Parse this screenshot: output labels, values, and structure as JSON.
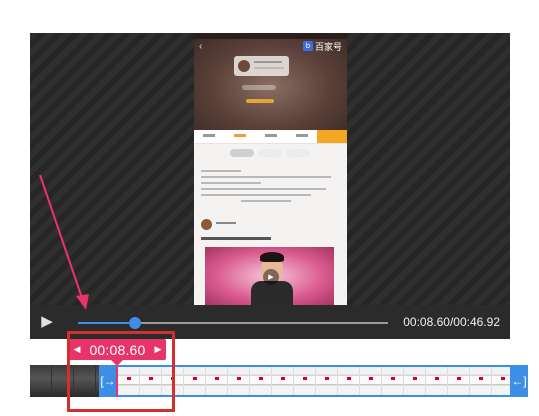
{
  "app": {
    "preview_brand": "百家号"
  },
  "player": {
    "play_icon": "play-icon",
    "time_readout": "00:08.60/00:46.92",
    "progress_fraction": 0.183
  },
  "trim": {
    "current_time": "00:08.60",
    "decrement_icon": "caret-left-icon",
    "increment_icon": "caret-right-icon",
    "start_handle_icon": "trim-start-icon",
    "end_handle_icon": "trim-end-icon"
  },
  "colors": {
    "accent_blue": "#3d8ee6",
    "tag_pink": "#e8336b",
    "annotation_red": "#d32f2f"
  }
}
